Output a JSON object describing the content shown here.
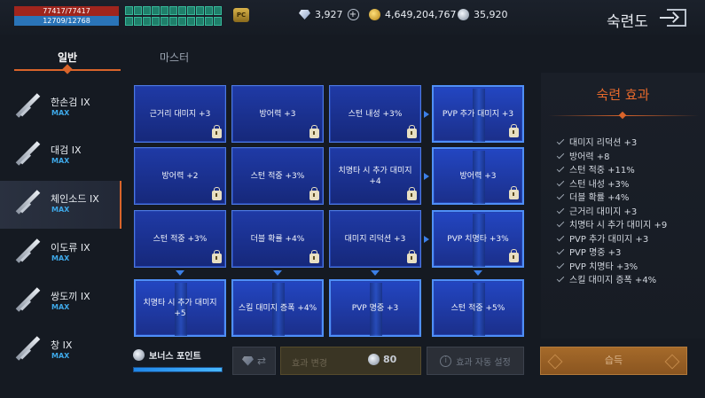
{
  "status": {
    "hp": "77417/77417",
    "mp": "12709/12768",
    "pc_badge": "PC"
  },
  "currency": {
    "diamond": "3,927",
    "gold": "4,649,204,767",
    "silver": "35,920"
  },
  "header": {
    "title": "숙련도"
  },
  "tabs": [
    {
      "label": "일반",
      "active": true
    },
    {
      "label": "마스터",
      "active": false
    }
  ],
  "weapons": [
    {
      "name": "한손검 IX",
      "level": "MAX",
      "selected": false
    },
    {
      "name": "대검 IX",
      "level": "MAX",
      "selected": false
    },
    {
      "name": "체인소드 IX",
      "level": "MAX",
      "selected": true
    },
    {
      "name": "이도류 IX",
      "level": "MAX",
      "selected": false
    },
    {
      "name": "쌍도끼 IX",
      "level": "MAX",
      "selected": false
    },
    {
      "name": "창 IX",
      "level": "MAX",
      "selected": false
    }
  ],
  "grid": [
    [
      "근거리 대미지 +3",
      "방어력 +3",
      "스턴 내성 +3%",
      "PVP 추가 대미지 +3"
    ],
    [
      "방어력 +2",
      "스턴 적중 +3%",
      "치명타 시 추가 대미지 +4",
      "방어력 +3"
    ],
    [
      "스턴 적중 +3%",
      "더블 확률 +4%",
      "대미지 리덕션 +3",
      "PVP 치명타 +3%"
    ],
    [
      "치명타 시 추가 대미지 +5",
      "스킬 대미지 증폭 +4%",
      "PVP 명중 +3",
      "스턴 적중 +5%"
    ]
  ],
  "effects": {
    "title": "숙련 효과",
    "items": [
      "대미지 리덕션 +3",
      "방어력 +8",
      "스턴 적중 +11%",
      "스턴 내성 +3%",
      "더블 확률 +4%",
      "근거리 대미지 +3",
      "치명타 시 추가 대미지 +9",
      "PVP 추가 대미지 +3",
      "PVP 명중 +3",
      "PVP 치명타 +3%",
      "스킬 대미지 증폭 +4%"
    ]
  },
  "bottom": {
    "bonus_label": "보너스 포인트",
    "bonus_progress": 1.0,
    "change_label": "효과 변경",
    "change_cost": "80",
    "auto_label": "효과 자동 설정",
    "learn_label": "습득"
  },
  "colors": {
    "accent": "#d9642a",
    "max": "#3ea8e8",
    "cell": "#1f3aa6"
  },
  "icons": [
    "diamond-icon",
    "plus-icon",
    "gold-coin-icon",
    "silver-coin-icon",
    "exit-icon",
    "lock-icon",
    "check-icon",
    "info-icon"
  ]
}
